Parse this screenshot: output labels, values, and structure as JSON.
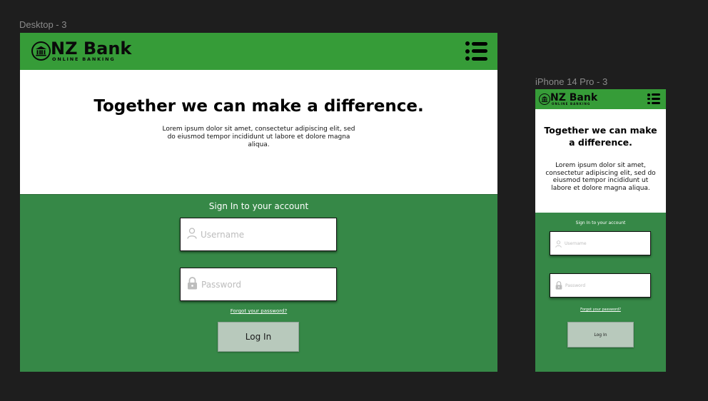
{
  "canvas": {
    "background": "#1e1e1e"
  },
  "desktop": {
    "frame_label": "Desktop - 3",
    "logo": {
      "name": "NZ Bank",
      "subtitle": "ONLINE BANKING"
    },
    "hero": {
      "title": "Together we can make a difference.",
      "body": "Lorem ipsum dolor sit amet, consectetur adipiscing elit, sed do eiusmod tempor incididunt ut labore et dolore magna aliqua."
    },
    "signin": {
      "title": "Sign In to your account",
      "username_placeholder": "Username",
      "password_placeholder": "Password",
      "forgot_link": "Forgot your password?",
      "login_label": "Log In"
    }
  },
  "mobile": {
    "frame_label": "iPhone 14 Pro - 3",
    "logo": {
      "name": "NZ Bank",
      "subtitle": "ONLINE BANKING"
    },
    "hero": {
      "title": "Together we can make a difference.",
      "body": "Lorem ipsum dolor sit amet, consectetur adipiscing elit, sed do eiusmod tempor incididunt ut labore et dolore magna aliqua."
    },
    "signin": {
      "title": "Sign In to your account",
      "username_placeholder": "Username",
      "password_placeholder": "Password",
      "forgot_link": "Forgot your password?",
      "login_label": "Log In"
    }
  },
  "colors": {
    "header_green": "#369c38",
    "signin_green": "#368847",
    "button_fill": "#b8c9bc",
    "placeholder": "#bcbcbc"
  },
  "icons": {
    "logo": "bank-building-icon",
    "menu": "menu-list-icon",
    "username": "user-icon",
    "password": "lock-icon"
  }
}
